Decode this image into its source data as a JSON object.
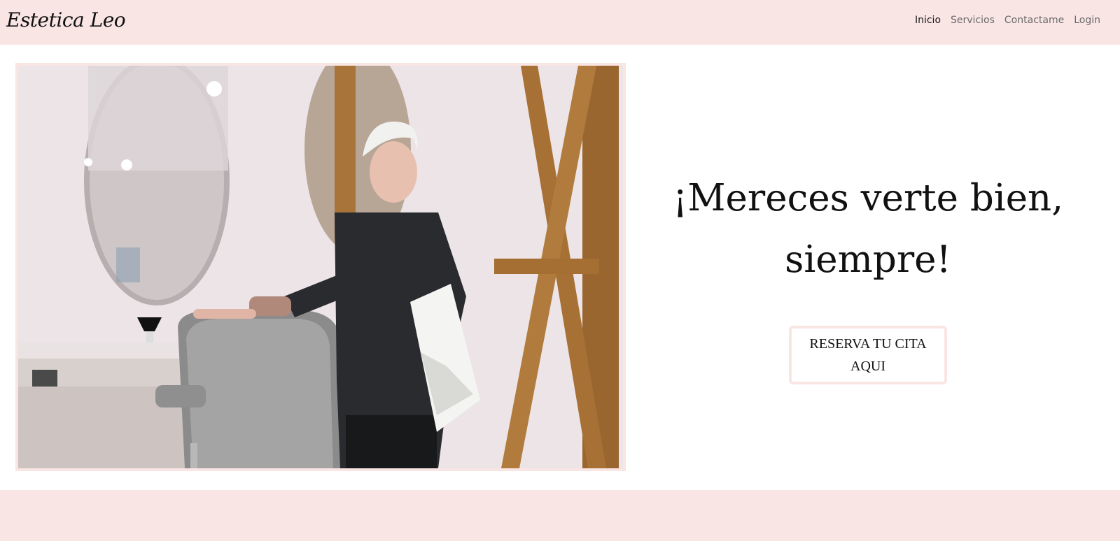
{
  "brand": {
    "name": "Estetica Leo"
  },
  "nav": {
    "items": [
      {
        "label": "Inicio",
        "active": true
      },
      {
        "label": "Servicios",
        "active": false
      },
      {
        "label": "Contactame",
        "active": false
      },
      {
        "label": "Login",
        "active": false
      }
    ]
  },
  "hero": {
    "headline": "¡Mereces verte bien, siempre!",
    "cta_label": "RESERVA TU CITA AQUI"
  },
  "colors": {
    "band_pink": "#fae5e5",
    "text_dark": "#111111",
    "nav_muted": "#6a6a6a"
  }
}
